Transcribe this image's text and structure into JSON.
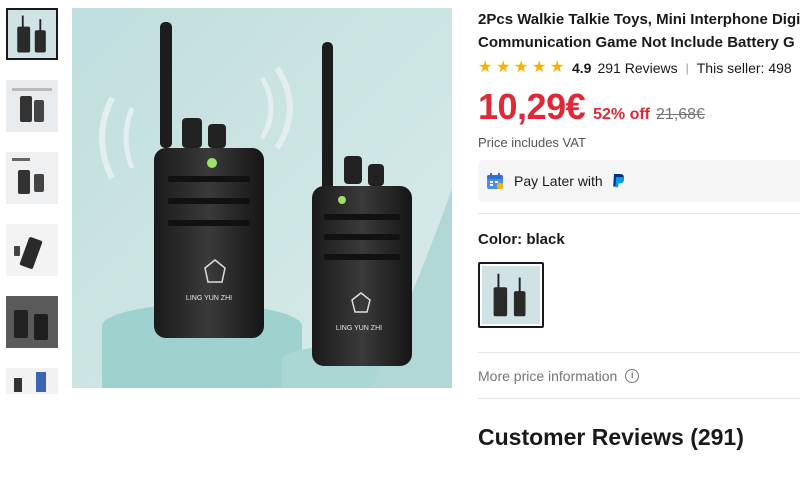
{
  "product": {
    "title_line1": "2Pcs Walkie Talkie Toys, Mini Interphone Digi",
    "title_line2": "Communication Game Not Include Battery G",
    "rating": "4.9",
    "reviews_link": "291 Reviews",
    "separator": "|",
    "seller": "This seller: 498",
    "price": "10,29€",
    "discount": "52% off",
    "original_price": "21,68€",
    "vat_note": "Price includes VAT",
    "pay_later_label": "Pay Later with",
    "color_label": "Color: black",
    "more_price_info": "More price information",
    "info_glyph": "i",
    "reviews_heading": "Customer Reviews (291)",
    "image_brand_text": "LING YUN ZHI",
    "stars": [
      "★",
      "★",
      "★",
      "★",
      "★"
    ]
  },
  "icons": {
    "star": "star-icon",
    "calendar": "calendar-icon",
    "paypal": "paypal-icon",
    "info": "info-icon"
  },
  "colors": {
    "price_red": "#e02837",
    "star_gold": "#fbb000",
    "paypal_blue": "#003087",
    "text_dark": "#191919",
    "text_muted": "#757575"
  }
}
